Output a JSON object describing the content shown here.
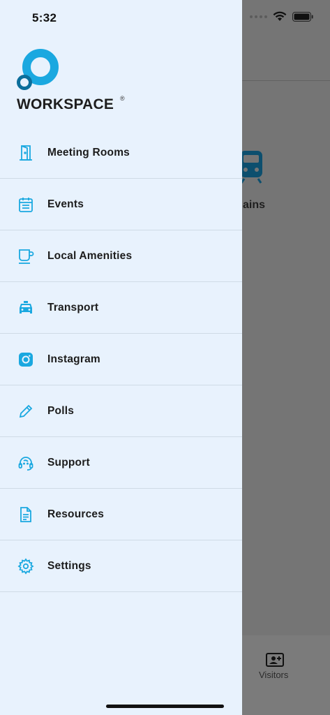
{
  "status_bar": {
    "time": "5:32"
  },
  "brand": {
    "name": "WORKSPACE",
    "registered_mark": "®",
    "accent": "#1aa8e0",
    "dark_accent": "#0b6e9b"
  },
  "menu": {
    "items": [
      {
        "label": "Meeting Rooms",
        "icon": "door-icon"
      },
      {
        "label": "Events",
        "icon": "calendar-icon"
      },
      {
        "label": "Local Amenities",
        "icon": "coffee-cup-icon"
      },
      {
        "label": "Transport",
        "icon": "taxi-icon"
      },
      {
        "label": "Instagram",
        "icon": "instagram-icon"
      },
      {
        "label": "Polls",
        "icon": "pencil-icon"
      },
      {
        "label": "Support",
        "icon": "headset-icon"
      },
      {
        "label": "Resources",
        "icon": "document-icon"
      },
      {
        "label": "Settings",
        "icon": "gear-icon"
      }
    ]
  },
  "background": {
    "tile_label": "ains",
    "tabbar": {
      "visitors_label": "Visitors"
    }
  },
  "colors": {
    "drawer_bg": "#e8f2fd",
    "icon": "#1aa8e0",
    "overlay": "#757575"
  }
}
